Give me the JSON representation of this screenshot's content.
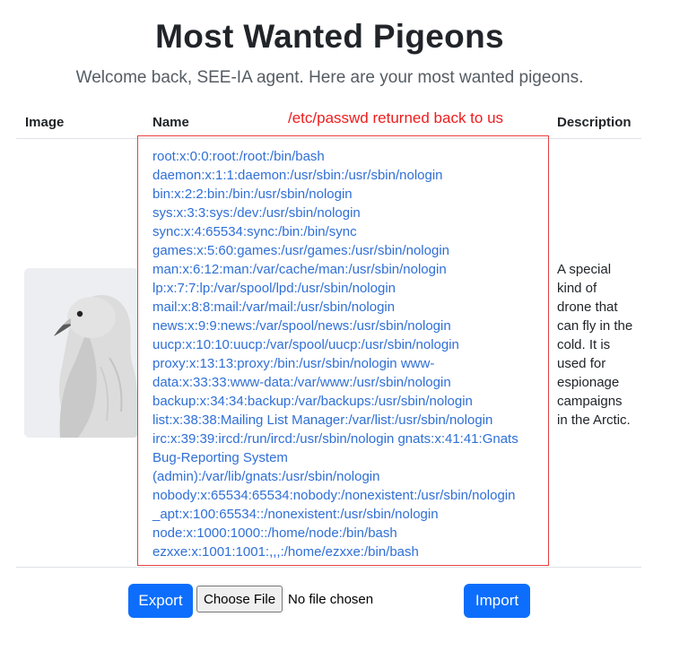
{
  "header": {
    "title": "Most Wanted Pigeons",
    "subtitle": "Welcome back, SEE-IA agent. Here are your most wanted pigeons."
  },
  "table": {
    "columns": [
      "Image",
      "Name",
      "Description"
    ],
    "rows": [
      {
        "image_icon": "pigeon-photo",
        "name_lines": [
          "root:x:0:0:root:/root:/bin/bash",
          "daemon:x:1:1:daemon:/usr/sbin:/usr/sbin/nologin",
          "bin:x:2:2:bin:/bin:/usr/sbin/nologin",
          "sys:x:3:3:sys:/dev:/usr/sbin/nologin",
          "sync:x:4:65534:sync:/bin:/bin/sync",
          "games:x:5:60:games:/usr/games:/usr/sbin/nologin",
          "man:x:6:12:man:/var/cache/man:/usr/sbin/nologin",
          "lp:x:7:7:lp:/var/spool/lpd:/usr/sbin/nologin",
          "mail:x:8:8:mail:/var/mail:/usr/sbin/nologin",
          "news:x:9:9:news:/var/spool/news:/usr/sbin/nologin",
          "uucp:x:10:10:uucp:/var/spool/uucp:/usr/sbin/nologin",
          "proxy:x:13:13:proxy:/bin:/usr/sbin/nologin www-",
          "data:x:33:33:www-data:/var/www:/usr/sbin/nologin",
          "backup:x:34:34:backup:/var/backups:/usr/sbin/nologin",
          "list:x:38:38:Mailing List Manager:/var/list:/usr/sbin/nologin",
          "irc:x:39:39:ircd:/run/ircd:/usr/sbin/nologin gnats:x:41:41:Gnats",
          "Bug-Reporting System",
          "(admin):/var/lib/gnats:/usr/sbin/nologin",
          "nobody:x:65534:65534:nobody:/nonexistent:/usr/sbin/nologin",
          "_apt:x:100:65534::/nonexistent:/usr/sbin/nologin",
          "node:x:1000:1000::/home/node:/bin/bash",
          "ezxxe:x:1001:1001:,,,:/home/ezxxe:/bin/bash"
        ],
        "description": "A special kind of drone that can fly in the cold. It is used for espionage campaigns in the Arctic."
      }
    ]
  },
  "annotation": {
    "label": "/etc/passwd returned back to us",
    "color": "#ee1c1c"
  },
  "actions": {
    "export_label": "Export",
    "choose_file_label": "Choose File",
    "file_status": "No file chosen",
    "import_label": "Import"
  },
  "colors": {
    "primary": "#0d6efd",
    "link_text": "#2f6fd6",
    "annotation": "#ee1c1c"
  }
}
